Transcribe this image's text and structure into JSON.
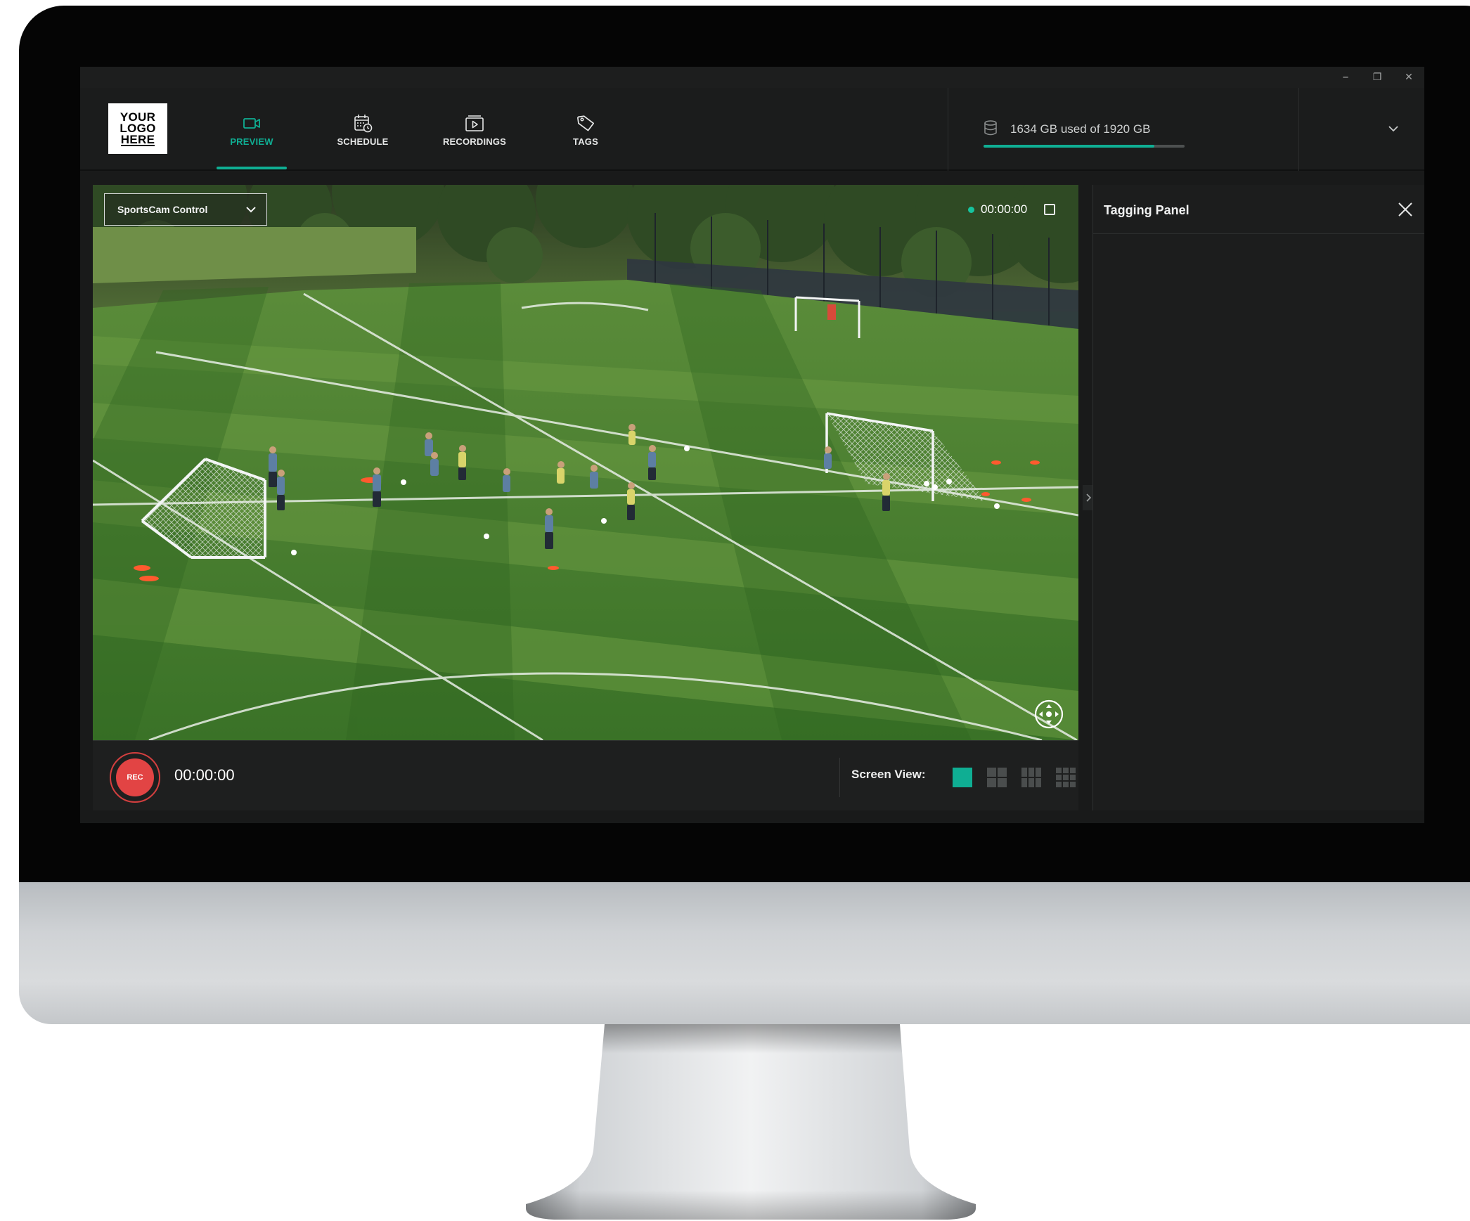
{
  "logo": {
    "lines": [
      "YOUR",
      "LOGO",
      "HERE"
    ]
  },
  "window_controls": {
    "minimize": "–",
    "maximize": "❐",
    "close": "✕"
  },
  "nav": {
    "tabs": [
      {
        "label": "PREVIEW",
        "icon": "video-camera-icon",
        "active": true
      },
      {
        "label": "SCHEDULE",
        "icon": "calendar-clock-icon",
        "active": false
      },
      {
        "label": "RECORDINGS",
        "icon": "play-folder-icon",
        "active": false
      },
      {
        "label": "TAGS",
        "icon": "tag-icon",
        "active": false
      }
    ]
  },
  "storage": {
    "label": "1634 GB used of 1920 GB",
    "used_gb": 1634,
    "total_gb": 1920,
    "icon": "database-icon"
  },
  "video": {
    "camera_select": "SportsCam Control",
    "live_timecode": "00:00:00",
    "status_color": "#16c49f"
  },
  "controls": {
    "rec_label": "REC",
    "rec_time": "00:00:00",
    "screen_view_label": "Screen View:",
    "screen_view_options": [
      "1x1",
      "2x2",
      "3x2",
      "3x3"
    ],
    "screen_view_selected": "1x1"
  },
  "tagging_panel": {
    "title": "Tagging Panel"
  },
  "colors": {
    "accent": "#0fae93",
    "record": "#e24444",
    "background": "#191a1a"
  }
}
